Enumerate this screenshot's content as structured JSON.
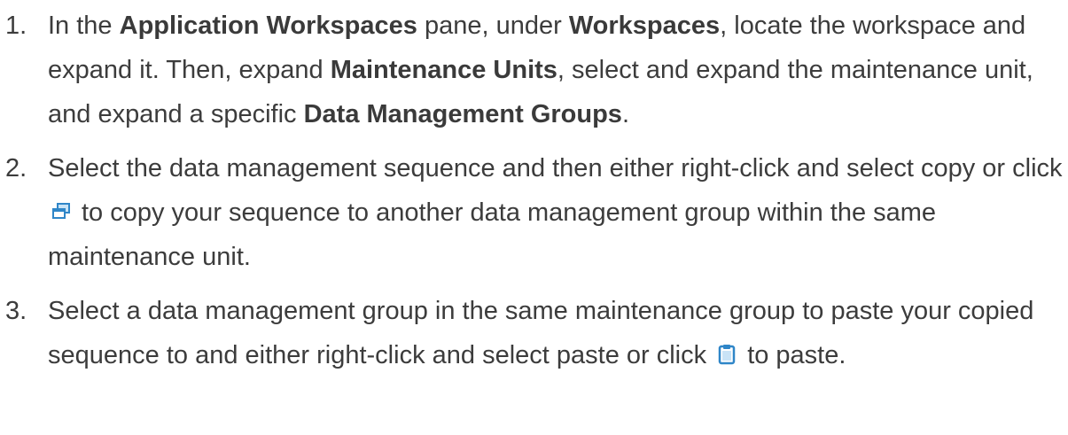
{
  "steps": [
    {
      "number": "1.",
      "segments": [
        {
          "text": "In the ",
          "bold": false
        },
        {
          "text": "Application Workspaces",
          "bold": true
        },
        {
          "text": " pane, under ",
          "bold": false
        },
        {
          "text": "Workspaces",
          "bold": true
        },
        {
          "text": ", locate the workspace and expand it. Then, expand ",
          "bold": false
        },
        {
          "text": "Maintenance Units",
          "bold": true
        },
        {
          "text": ", select and expand the maintenance unit, and expand a specific ",
          "bold": false
        },
        {
          "text": "Data Management Groups",
          "bold": true
        },
        {
          "text": ".",
          "bold": false
        }
      ]
    },
    {
      "number": "2.",
      "text_before_icon": "Select the data management sequence and then either right-click and select copy or click",
      "icon": "copy-icon",
      "text_after_icon": "to copy your sequence to another data management group within the same maintenance unit."
    },
    {
      "number": "3.",
      "text_before_icon": "Select a data management group in the same maintenance group to paste your copied sequence to and either right-click and select paste or click",
      "icon": "paste-icon",
      "text_after_icon": "to paste."
    }
  ],
  "colors": {
    "text": "#3c3c3c",
    "icon_blue": "#2f86c8",
    "icon_light_blue": "#c9e3f6"
  }
}
